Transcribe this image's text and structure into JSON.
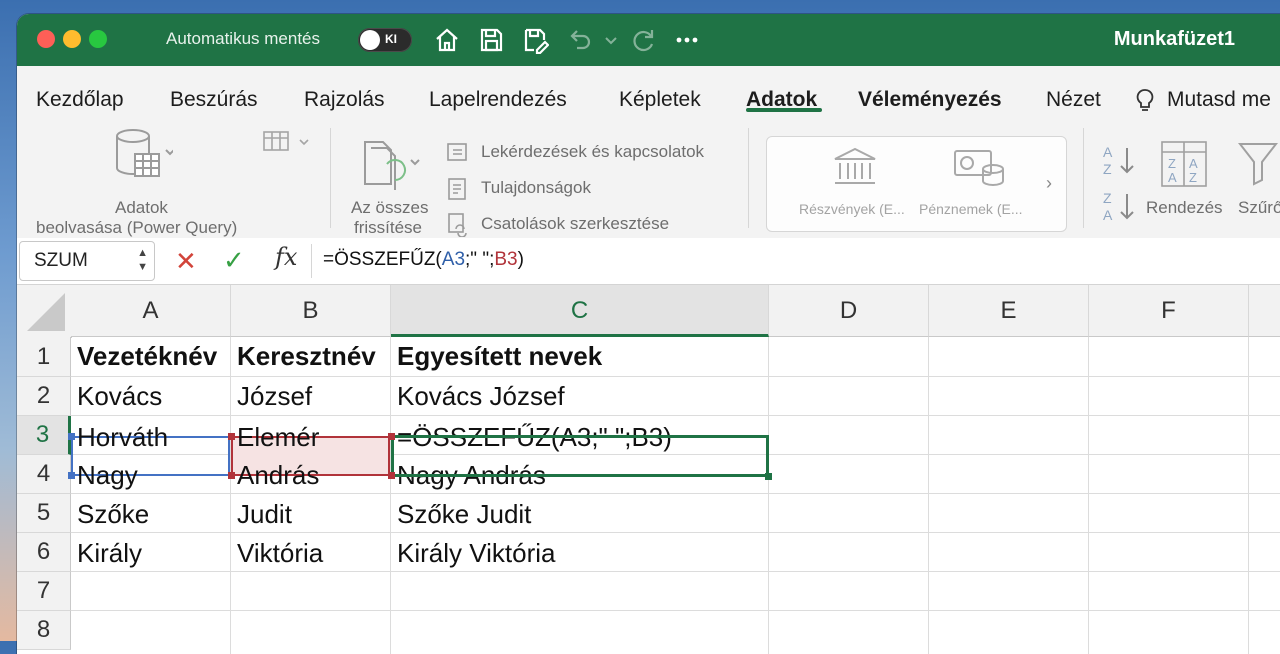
{
  "titlebar": {
    "autosave_label": "Automatikus mentés",
    "toggle_state": "KI",
    "doc_title": "Munkafüzet1"
  },
  "tabs": [
    "Kezdőlap",
    "Beszúrás",
    "Rajzolás",
    "Lapelrendezés",
    "Képletek",
    "Adatok",
    "Véleményezés",
    "Nézet",
    "Mutasd me"
  ],
  "active_tab": "Adatok",
  "ribbon": {
    "get_data_line1": "Adatok",
    "get_data_line2": "beolvasása (Power Query)",
    "refresh_line1": "Az összes",
    "refresh_line2": "frissítése",
    "queries": "Lekérdezések és kapcsolatok",
    "properties": "Tulajdonságok",
    "edit_links": "Csatolások szerkesztése",
    "stocks": "Részvények (E...",
    "currencies": "Pénznemek (E...",
    "sort": "Rendezés",
    "filter": "Szűrő"
  },
  "formula_bar": {
    "name_box": "SZUM",
    "formula_prefix": "=ÖSSZEFŰZ(",
    "ref1": "A3",
    "formula_mid": ";\" \";",
    "ref2": "B3",
    "formula_suffix": ")"
  },
  "columns": [
    "A",
    "B",
    "C",
    "D",
    "E",
    "F"
  ],
  "rows": [
    "1",
    "2",
    "3",
    "4",
    "5",
    "6",
    "7",
    "8"
  ],
  "cells": {
    "A1": "Vezetéknév",
    "B1": "Keresztnév",
    "C1": "Egyesített nevek",
    "A2": "Kovács",
    "B2": "József",
    "C2": "Kovács József",
    "A3": "Horváth",
    "B3": "Elemér",
    "C3": "=ÖSSZEFŰZ(A3;\" \";B3)",
    "A4": "Nagy",
    "B4": "András",
    "C4": "Nagy András",
    "A5": "Szőke",
    "B5": "Judit",
    "C5": "Szőke Judit",
    "A6": "Király",
    "B6": "Viktória",
    "C6": "Király Viktória"
  },
  "colors": {
    "excel_green": "#1f7345",
    "ref_blue": "#4472c4",
    "ref_red": "#b1333a"
  }
}
